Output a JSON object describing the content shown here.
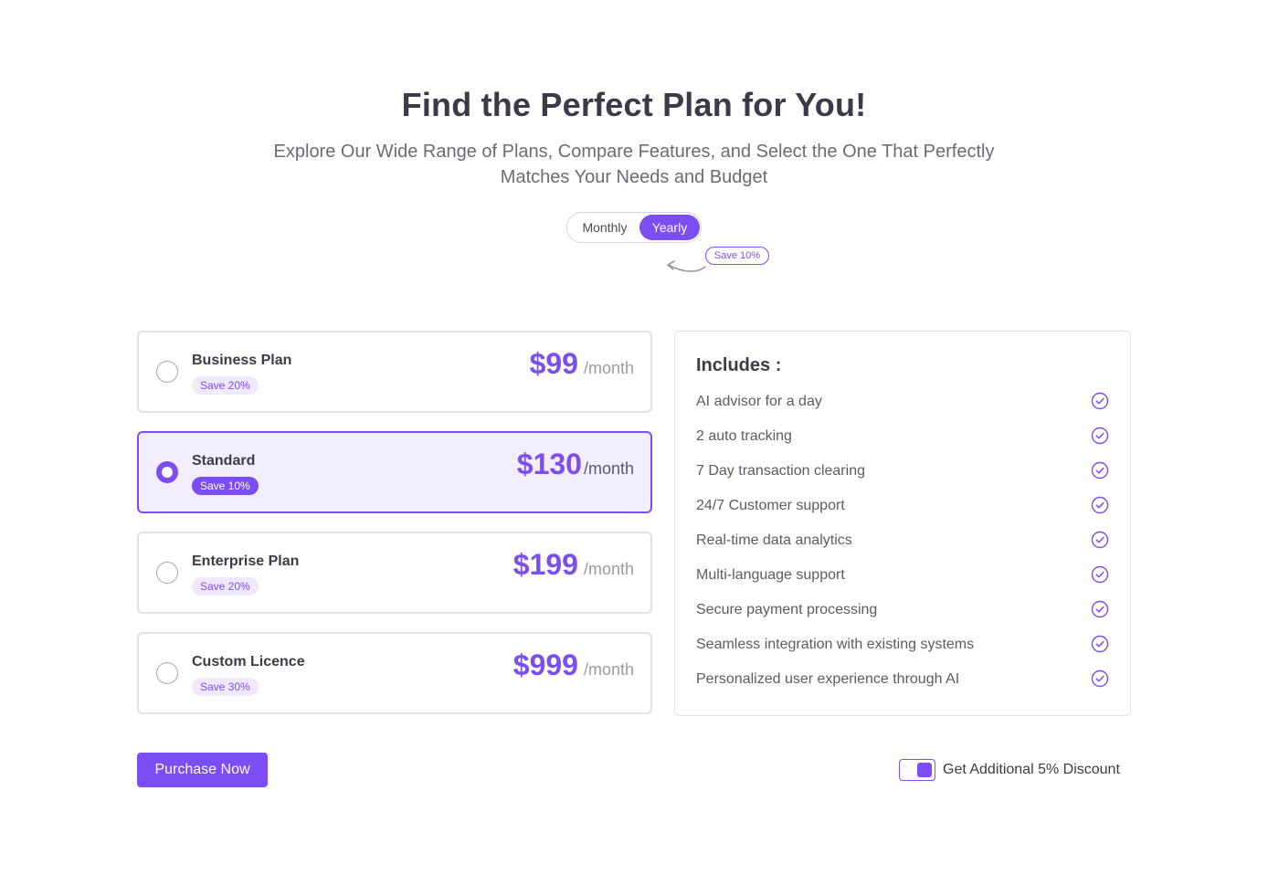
{
  "header": {
    "title": "Find the Perfect Plan for You!",
    "subtitle_line1": "Explore Our Wide Range of Plans, Compare Features, and Select the One That Perfectly",
    "subtitle_line2": "Matches Your Needs and Budget"
  },
  "billing_toggle": {
    "monthly_label": "Monthly",
    "yearly_label": "Yearly",
    "selected": "Yearly",
    "save_badge": "Save 10%"
  },
  "plans": [
    {
      "name": "Business Plan",
      "badge": "Save 20%",
      "price": "$99",
      "period": "/month",
      "selected": false
    },
    {
      "name": "Standard",
      "badge": "Save 10%",
      "price": "$130",
      "period": "/month",
      "selected": true
    },
    {
      "name": "Enterprise Plan",
      "badge": "Save 20%",
      "price": "$199",
      "period": "/month",
      "selected": false
    },
    {
      "name": "Custom Licence",
      "badge": "Save 30%",
      "price": "$999",
      "period": "/month",
      "selected": false
    }
  ],
  "includes": {
    "heading": "Includes :",
    "features": [
      "AI advisor for a day",
      "2 auto tracking",
      "7 Day transaction clearing",
      "24/7 Customer support",
      "Real-time data analytics",
      "Multi-language support",
      "Secure payment processing",
      "Seamless integration with existing systems",
      "Personalized user experience through AI"
    ]
  },
  "footer": {
    "purchase_label": "Purchase Now",
    "discount_label": "Get Additional 5% Discount",
    "discount_enabled": true
  },
  "colors": {
    "accent": "#7c4df2",
    "selected_bg": "#f2eefd",
    "badge_bg": "#efe9fd"
  }
}
